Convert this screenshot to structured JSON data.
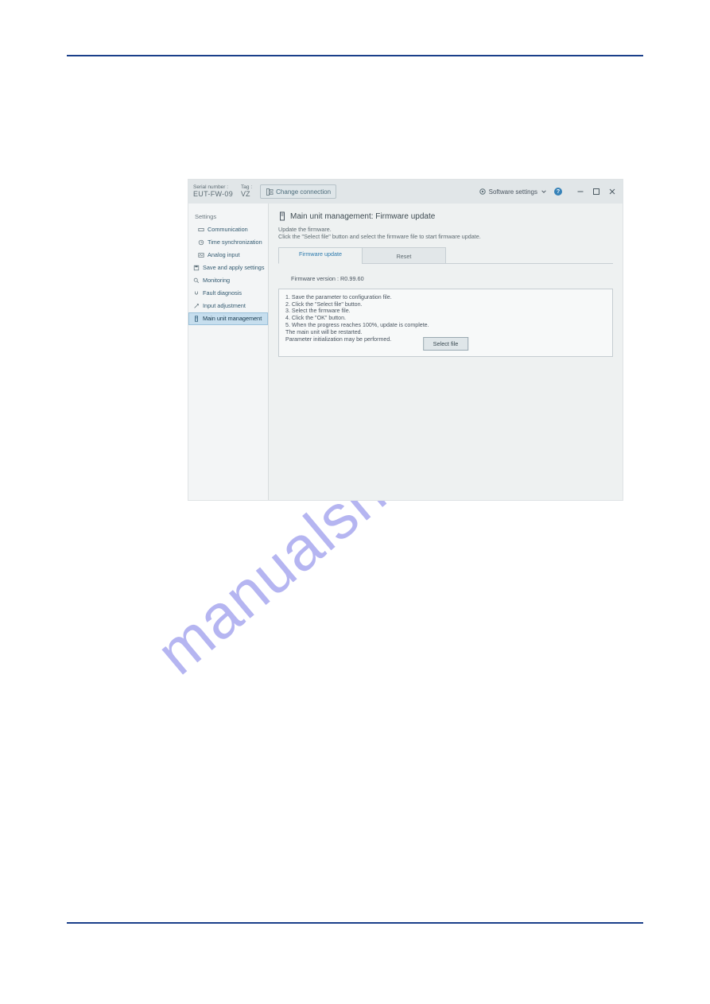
{
  "watermark": "manualshive.com",
  "titlebar": {
    "serial_label": "Serial number :",
    "serial_value": "EUT-FW-09",
    "tag_label": "Tag :",
    "tag_value": "VZ",
    "change_connection": "Change connection",
    "software_settings": "Software settings"
  },
  "sidebar": {
    "heading": "Settings",
    "items": [
      {
        "label": "Communication"
      },
      {
        "label": "Time synchronization"
      },
      {
        "label": "Analog input"
      },
      {
        "label": "Save and apply settings"
      },
      {
        "label": "Monitoring"
      },
      {
        "label": "Fault diagnosis"
      },
      {
        "label": "Input adjustment"
      },
      {
        "label": "Main unit management"
      }
    ]
  },
  "main": {
    "title": "Main unit management:  Firmware update",
    "desc_line1": "Update the firmware.",
    "desc_line2": "Click the \"Select file\" button and select the firmware file to start firmware update.",
    "tabs": {
      "firmware_update": "Firmware update",
      "reset": "Reset"
    },
    "firmware_version": "Firmware version : R0.99.60",
    "steps": "1. Save the parameter to configuration file.\n2. Click the \"Select file\" button.\n3. Select the firmware file.\n4. Click the \"OK\" button.\n5. When the progress reaches 100%, update is complete.\nThe main unit will be restarted.\nParameter initialization may be performed.",
    "select_file": "Select file"
  }
}
